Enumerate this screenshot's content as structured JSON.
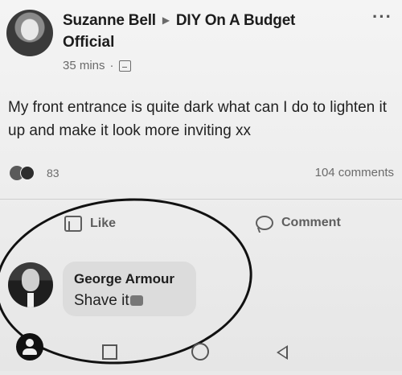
{
  "post": {
    "author": "Suzanne Bell",
    "group_line1": "DIY On A Budget",
    "group_line2": "Official",
    "time": "35 mins",
    "meta_separator": "·",
    "more": "···",
    "text": "My front entrance is quite dark what can I do to lighten it up and make it look more inviting xx",
    "reaction_count": "83",
    "comment_count": "104 comments"
  },
  "actions": {
    "like_label": "Like",
    "comment_label": "Comment"
  },
  "comment": {
    "author": "George Armour",
    "text": "Shave it"
  },
  "icons": {
    "more": "more-options-icon",
    "privacy": "globe-icon",
    "like": "thumbs-up-icon",
    "comment": "speech-bubble-icon"
  }
}
